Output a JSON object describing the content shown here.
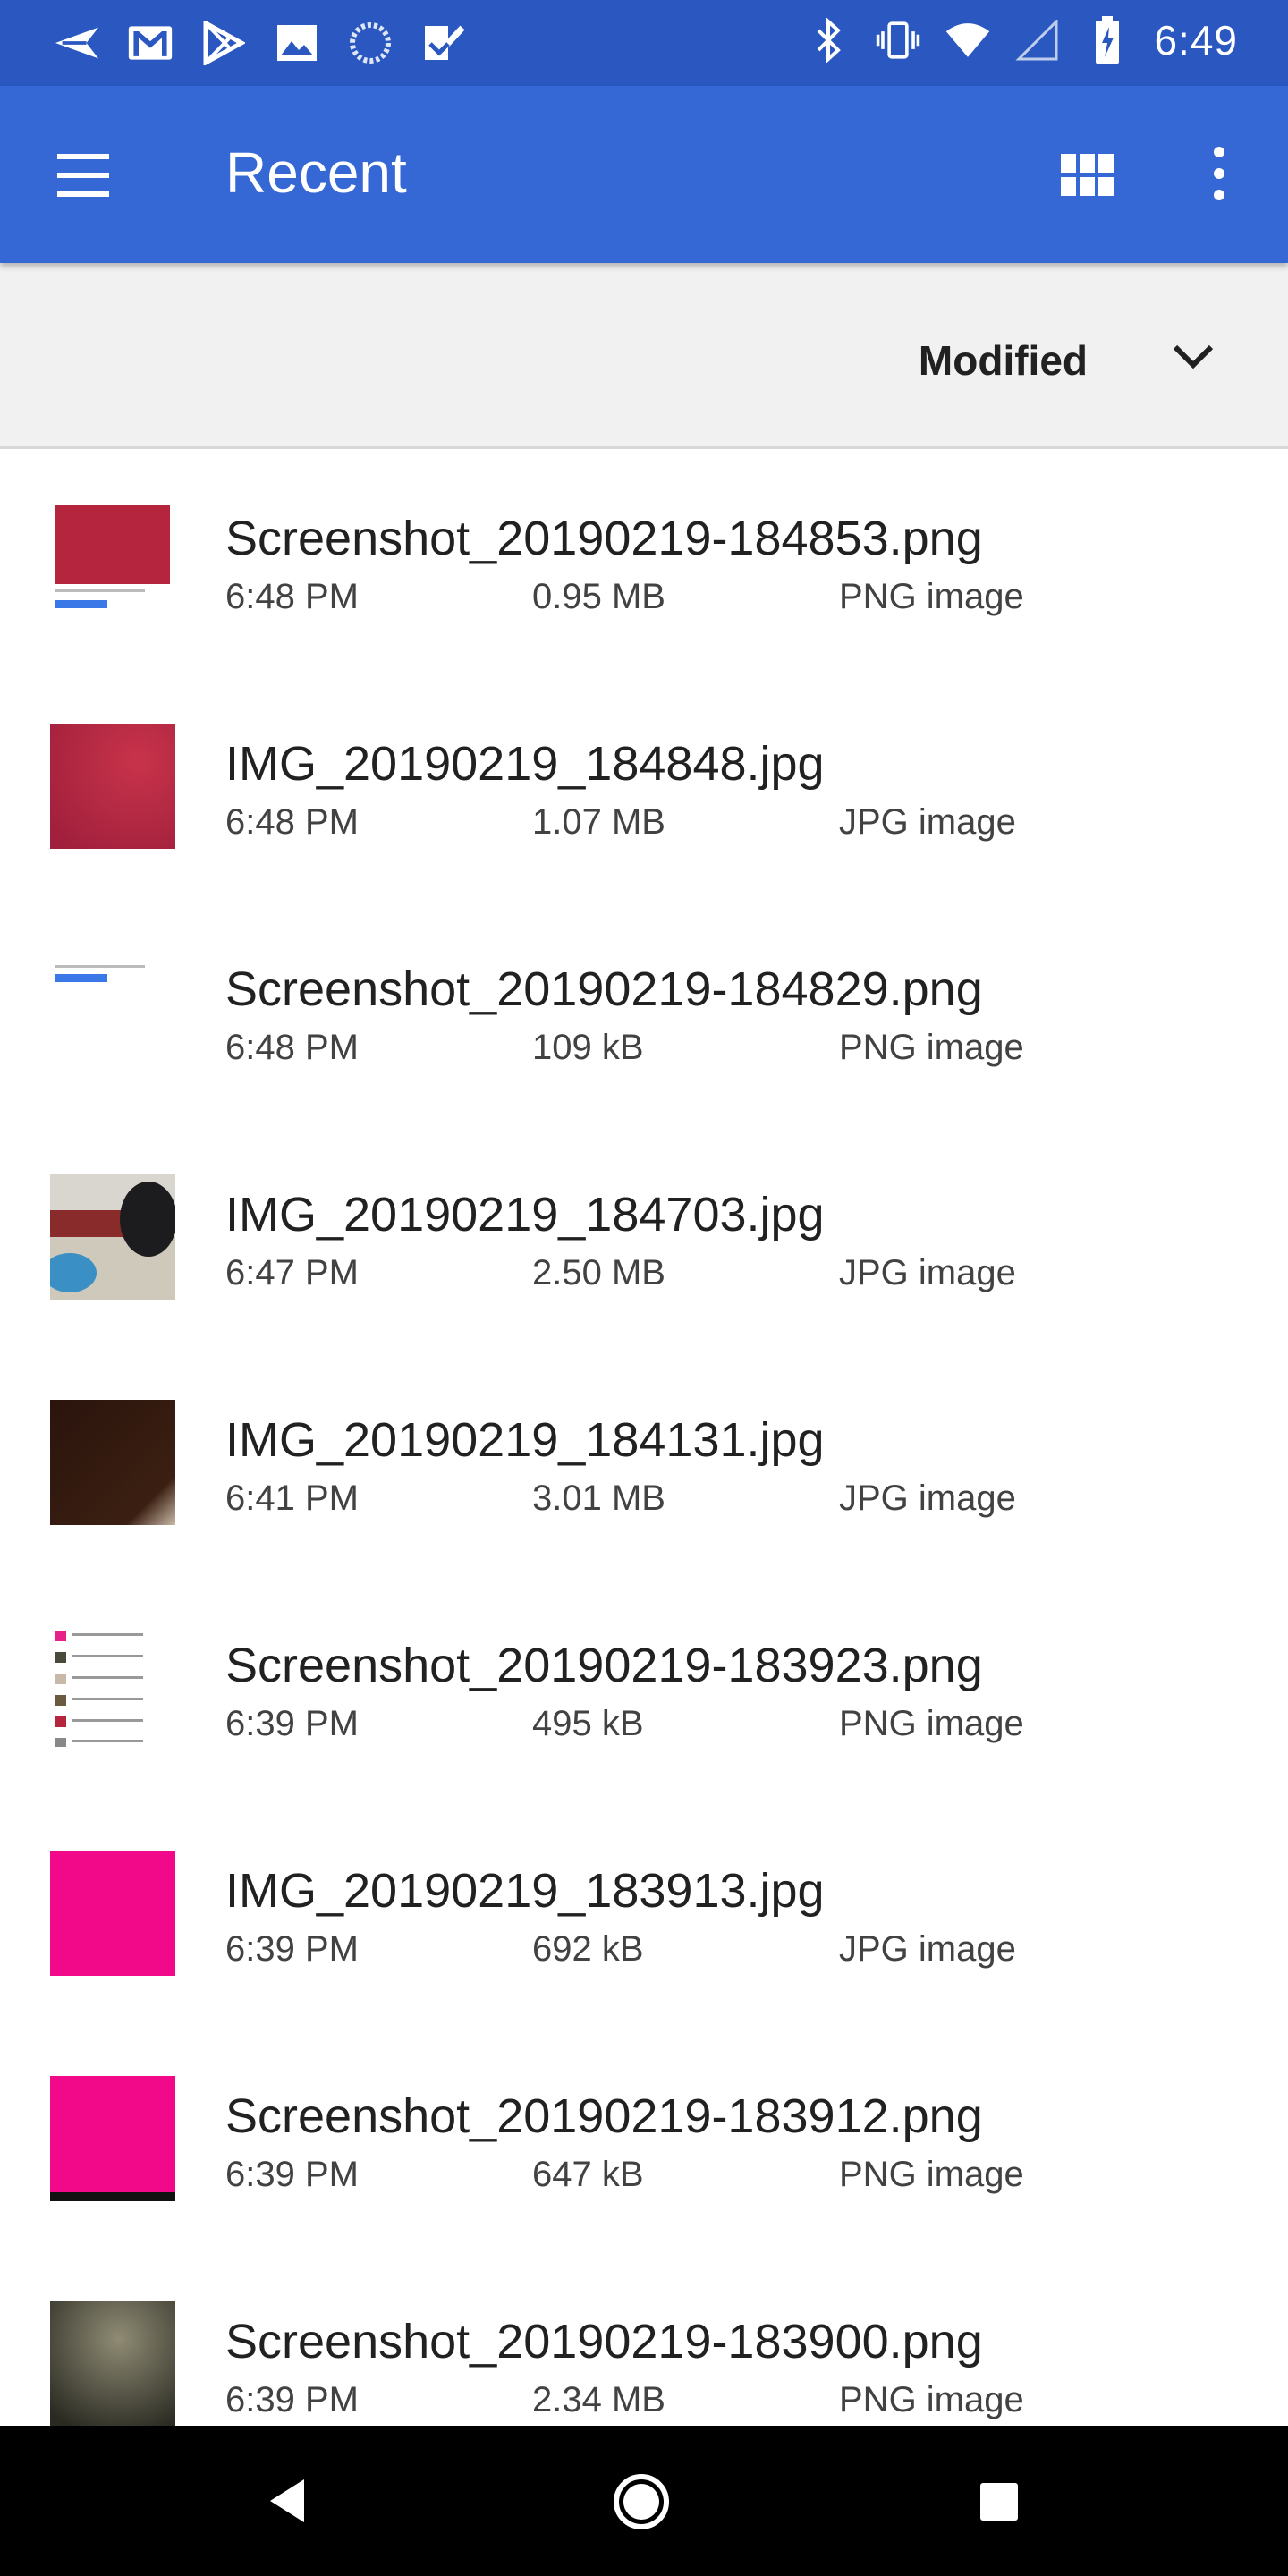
{
  "status_bar": {
    "time": "6:49",
    "left_icons": [
      "send-icon",
      "gmail-icon",
      "play-store-icon",
      "photos-icon",
      "loading-icon",
      "tasks-icon"
    ],
    "right_icons": [
      "bluetooth-icon",
      "vibrate-icon",
      "wifi-icon",
      "signal-icon",
      "battery-charging-icon"
    ]
  },
  "app_bar": {
    "title": "Recent"
  },
  "sort_bar": {
    "label": "Modified"
  },
  "files": [
    {
      "name": "Screenshot_20190219-184853.png",
      "time": "6:48 PM",
      "size": "0.95 MB",
      "type": "PNG image",
      "thumb": "screenshot-red"
    },
    {
      "name": "IMG_20190219_184848.jpg",
      "time": "6:48 PM",
      "size": "1.07 MB",
      "type": "JPG image",
      "thumb": "photo-crimson"
    },
    {
      "name": "Screenshot_20190219-184829.png",
      "time": "6:48 PM",
      "size": "109 kB",
      "type": "PNG image",
      "thumb": "screenshot-white"
    },
    {
      "name": "IMG_20190219_184703.jpg",
      "time": "6:47 PM",
      "size": "2.50 MB",
      "type": "JPG image",
      "thumb": "photo-room"
    },
    {
      "name": "IMG_20190219_184131.jpg",
      "time": "6:41 PM",
      "size": "3.01 MB",
      "type": "JPG image",
      "thumb": "photo-dark"
    },
    {
      "name": "Screenshot_20190219-183923.png",
      "time": "6:39 PM",
      "size": "495 kB",
      "type": "PNG image",
      "thumb": "screenshot-list"
    },
    {
      "name": "IMG_20190219_183913.jpg",
      "time": "6:39 PM",
      "size": "692 kB",
      "type": "JPG image",
      "thumb": "photo-magenta"
    },
    {
      "name": "Screenshot_20190219-183912.png",
      "time": "6:39 PM",
      "size": "647 kB",
      "type": "PNG image",
      "thumb": "screenshot-magenta"
    },
    {
      "name": "Screenshot_20190219-183900.png",
      "time": "6:39 PM",
      "size": "2.34 MB",
      "type": "PNG image",
      "thumb": "screenshot-gray"
    }
  ],
  "colors": {
    "status_bar": "#2a58c0",
    "app_bar": "#3568d4",
    "sort_bar": "#f1f1f1"
  }
}
